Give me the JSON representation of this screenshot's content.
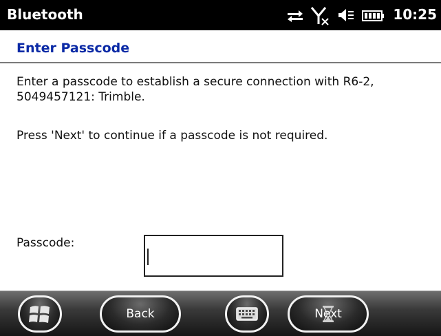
{
  "titlebar": {
    "app_title": "Bluetooth",
    "clock": "10:25",
    "icons": [
      "data-sync-icon",
      "no-signal-icon",
      "speaker-muted-icon",
      "battery-icon"
    ]
  },
  "page": {
    "title": "Enter Passcode",
    "paragraph1": "Enter a passcode to establish a secure connection with R6-2, 5049457121: Trimble.",
    "paragraph2": "Press 'Next' to continue if a passcode is not required."
  },
  "form": {
    "passcode_label": "Passcode:",
    "passcode_value": ""
  },
  "menubar": {
    "start_icon": "windows-logo-icon",
    "back_label": "Back",
    "keyboard_icon": "keyboard-icon",
    "next_label": "Next",
    "busy_icon": "hourglass-icon"
  },
  "colors": {
    "title_blue": "#0b2aa6",
    "titlebar_bg": "#000000"
  }
}
